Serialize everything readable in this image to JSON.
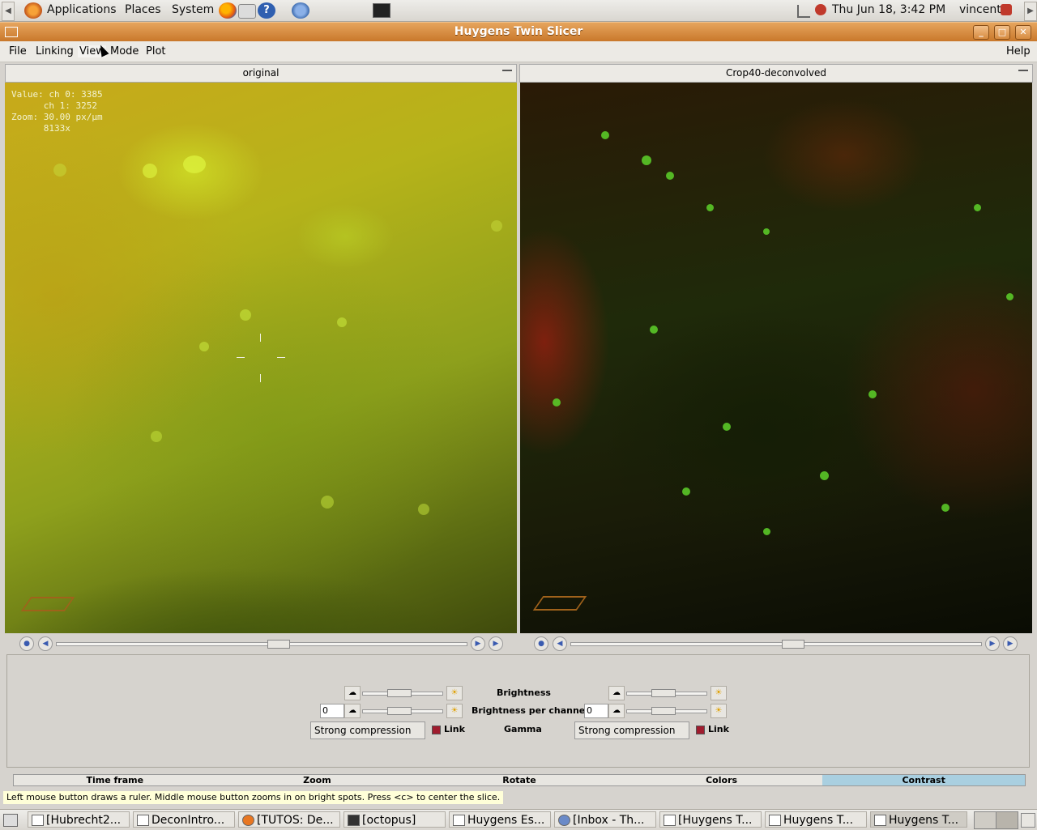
{
  "top_panel": {
    "menus": [
      "Applications",
      "Places",
      "System"
    ],
    "clock": "Thu Jun 18,  3:42 PM",
    "user": "vincent"
  },
  "window": {
    "title": "Huygens Twin Slicer"
  },
  "menubar": {
    "items": [
      "File",
      "Linking",
      "View",
      "Mode",
      "Plot"
    ],
    "help": "Help"
  },
  "viewers": {
    "left": {
      "title": "original",
      "overlay": "Value: ch 0: 3385\n      ch 1: 3252\nZoom: 30.00 px/µm\n      8133x"
    },
    "right": {
      "title": "Crop40-deconvolved"
    }
  },
  "controls": {
    "brightness": "Brightness",
    "brightness_per_channel": "Brightness per channel",
    "gamma": "Gamma",
    "left": {
      "channel": "0",
      "compression": "Strong compression",
      "link": "Link"
    },
    "right": {
      "channel": "0",
      "compression": "Strong compression",
      "link": "Link"
    }
  },
  "tabs": [
    "Time frame",
    "Zoom",
    "Rotate",
    "Colors",
    "Contrast"
  ],
  "active_tab": "Contrast",
  "status": "Left mouse button draws a ruler. Middle mouse button zooms in on bright spots. Press <c> to center the slice.",
  "taskbar": [
    "[Hubrecht2...",
    "DeconIntro...",
    "[TUTOS: De...",
    "[octopus]",
    "Huygens Es...",
    "[Inbox - Th...",
    "[Huygens T...",
    "Huygens T...",
    "Huygens T..."
  ]
}
